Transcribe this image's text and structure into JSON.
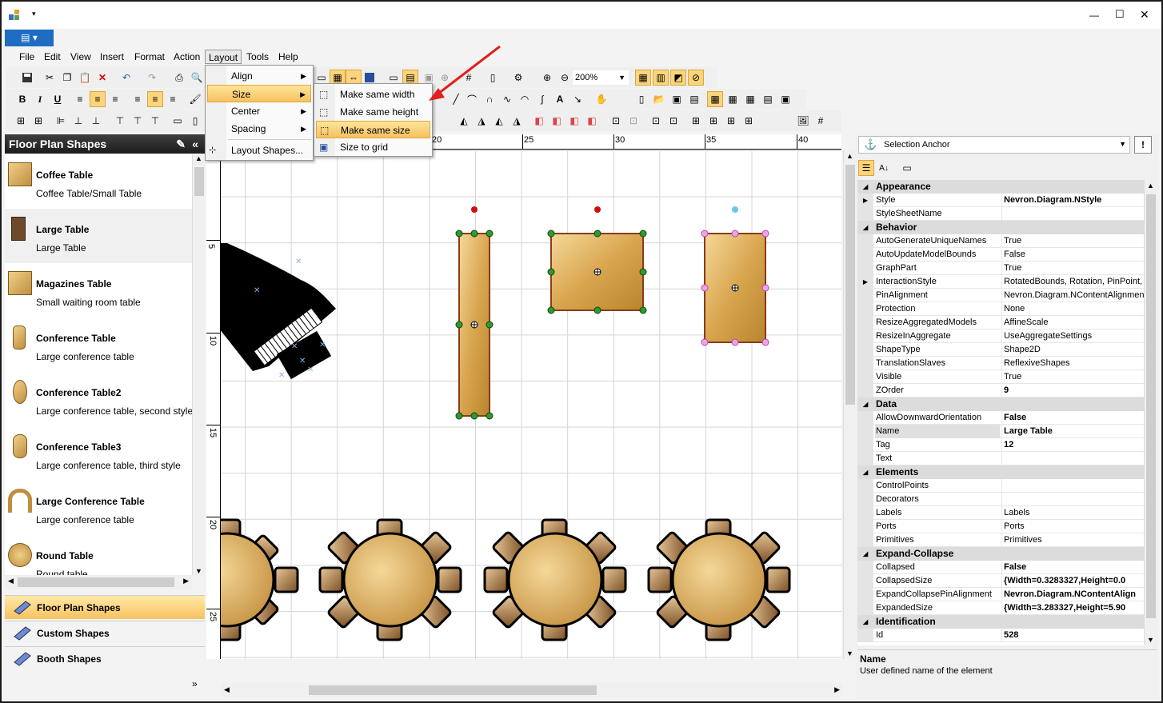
{
  "window": {
    "quick_access_label": "▤ ▾",
    "controls": {
      "minimize": "—",
      "maximize": "☐",
      "close": "✕"
    }
  },
  "menubar": {
    "items": [
      "File",
      "Edit",
      "View",
      "Insert",
      "Format",
      "Action",
      "Layout",
      "Tools",
      "Help"
    ],
    "active": "Layout"
  },
  "toolbar": {
    "zoom_value": "200%"
  },
  "layout_menu": {
    "items": [
      {
        "label": "Align",
        "has_submenu": true
      },
      {
        "label": "Size",
        "has_submenu": true,
        "highlighted": true
      },
      {
        "label": "Center",
        "has_submenu": true
      },
      {
        "label": "Spacing",
        "has_submenu": true
      },
      {
        "label": "Layout Shapes...",
        "has_submenu": false
      }
    ]
  },
  "size_submenu": {
    "items": [
      {
        "label": "Make same width"
      },
      {
        "label": "Make same height"
      },
      {
        "label": "Make same size",
        "highlighted": true
      },
      {
        "label": "Size to grid"
      }
    ]
  },
  "shapes_panel": {
    "title": "Floor Plan Shapes",
    "items": [
      {
        "name": "Coffee Table",
        "desc": "Coffee Table/Small Table",
        "icon": "coffee-table-icon"
      },
      {
        "name": "Large Table",
        "desc": "Large Table",
        "icon": "large-table-icon",
        "selected": true
      },
      {
        "name": "Magazines Table",
        "desc": "Small waiting room table",
        "icon": "magazines-table-icon"
      },
      {
        "name": "Conference Table",
        "desc": "Large conference table",
        "icon": "conference-table-icon"
      },
      {
        "name": "Conference Table2",
        "desc": "Large conference table, second style",
        "icon": "conference-table2-icon"
      },
      {
        "name": "Conference Table3",
        "desc": "Large conference table, third style",
        "icon": "conference-table3-icon"
      },
      {
        "name": "Large Conference Table",
        "desc": "Large conference table",
        "icon": "large-conference-table-icon"
      },
      {
        "name": "Round Table",
        "desc": "Round table",
        "icon": "round-table-icon"
      }
    ],
    "categories": [
      {
        "label": "Floor Plan Shapes",
        "active": true
      },
      {
        "label": "Custom Shapes",
        "active": false
      },
      {
        "label": "Booth Shapes",
        "active": false
      }
    ]
  },
  "ruler": {
    "top_labels": [
      "20",
      "25",
      "30",
      "35",
      "40"
    ],
    "left_labels": [
      "5",
      "10",
      "15",
      "20",
      "25"
    ]
  },
  "properties": {
    "selector_label": "Selection Anchor",
    "categories": [
      {
        "name": "Appearance",
        "rows": [
          {
            "name": "Style",
            "value": "Nevron.Diagram.NStyle",
            "bold": true,
            "expandable": true
          },
          {
            "name": "StyleSheetName",
            "value": ""
          }
        ]
      },
      {
        "name": "Behavior",
        "rows": [
          {
            "name": "AutoGenerateUniqueNames",
            "value": "True"
          },
          {
            "name": "AutoUpdateModelBounds",
            "value": "False"
          },
          {
            "name": "GraphPart",
            "value": "True"
          },
          {
            "name": "InteractionStyle",
            "value": "RotatedBounds, Rotation, PinPoint, S",
            "expandable": true
          },
          {
            "name": "PinAlignment",
            "value": "Nevron.Diagram.NContentAlignment"
          },
          {
            "name": "Protection",
            "value": "None"
          },
          {
            "name": "ResizeAggregatedModels",
            "value": "AffineScale"
          },
          {
            "name": "ResizeInAggregate",
            "value": "UseAggregateSettings"
          },
          {
            "name": "ShapeType",
            "value": "Shape2D"
          },
          {
            "name": "TranslationSlaves",
            "value": "ReflexiveShapes"
          },
          {
            "name": "Visible",
            "value": "True"
          },
          {
            "name": "ZOrder",
            "value": "9",
            "bold": true
          }
        ]
      },
      {
        "name": "Data",
        "rows": [
          {
            "name": "AllowDownwardOrientation",
            "value": "False",
            "bold": true
          },
          {
            "name": "Name",
            "value": "Large Table",
            "bold": true,
            "selected": true
          },
          {
            "name": "Tag",
            "value": "12",
            "bold": true
          },
          {
            "name": "Text",
            "value": ""
          }
        ]
      },
      {
        "name": "Elements",
        "rows": [
          {
            "name": "ControlPoints",
            "value": ""
          },
          {
            "name": "Decorators",
            "value": ""
          },
          {
            "name": "Labels",
            "value": "Labels"
          },
          {
            "name": "Ports",
            "value": "Ports"
          },
          {
            "name": "Primitives",
            "value": "Primitives"
          }
        ]
      },
      {
        "name": "Expand-Collapse",
        "rows": [
          {
            "name": "Collapsed",
            "value": "False",
            "bold": true
          },
          {
            "name": "CollapsedSize",
            "value": "{Width=0.3283327,Height=0.0",
            "bold": true
          },
          {
            "name": "ExpandCollapsePinAlignment",
            "value": "Nevron.Diagram.NContentAlign",
            "bold": true
          },
          {
            "name": "ExpandedSize",
            "value": "{Width=3.283327,Height=5.90",
            "bold": true
          }
        ]
      },
      {
        "name": "Identification",
        "rows": [
          {
            "name": "Id",
            "value": "528",
            "bold": true
          }
        ]
      }
    ],
    "help_title": "Name",
    "help_text": "User defined name of the element"
  }
}
